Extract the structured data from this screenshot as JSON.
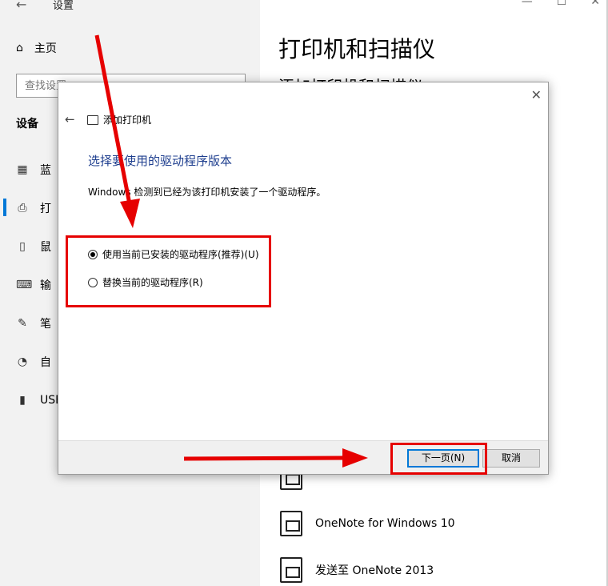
{
  "settings": {
    "back_icon": "back-arrow-icon",
    "window_title": "设置",
    "home_label": "主页",
    "search_placeholder": "查找设置",
    "section": "设备",
    "sidebar_items": [
      {
        "icon": "bluetooth-icon",
        "label": "蓝"
      },
      {
        "icon": "printer-icon",
        "label": "打"
      },
      {
        "icon": "mouse-icon",
        "label": "鼠"
      },
      {
        "icon": "keyboard-icon",
        "label": "输"
      },
      {
        "icon": "pen-icon",
        "label": "笔"
      },
      {
        "icon": "autoplay-icon",
        "label": "自"
      },
      {
        "icon": "usb-icon",
        "label": "USE"
      }
    ],
    "main_title": "打印机和扫描仪",
    "main_subtitle": "添加打印机和扫描仪",
    "printers": [
      {
        "label": ""
      },
      {
        "label": "OneNote for Windows 10"
      },
      {
        "label": "发送至 OneNote 2013"
      }
    ]
  },
  "dialog": {
    "title": "添加打印机",
    "heading": "选择要使用的驱动程序版本",
    "description": "Windows 检测到已经为该打印机安装了一个驱动程序。",
    "options": [
      {
        "label": "使用当前已安装的驱动程序(推荐)(U)",
        "checked": true
      },
      {
        "label": "替换当前的驱动程序(R)",
        "checked": false
      }
    ],
    "next_button": "下一页(N)",
    "cancel_button": "取消"
  },
  "colors": {
    "accent": "#0078d7",
    "annotation_red": "#e60000",
    "heading_blue": "#1f3f8f"
  }
}
